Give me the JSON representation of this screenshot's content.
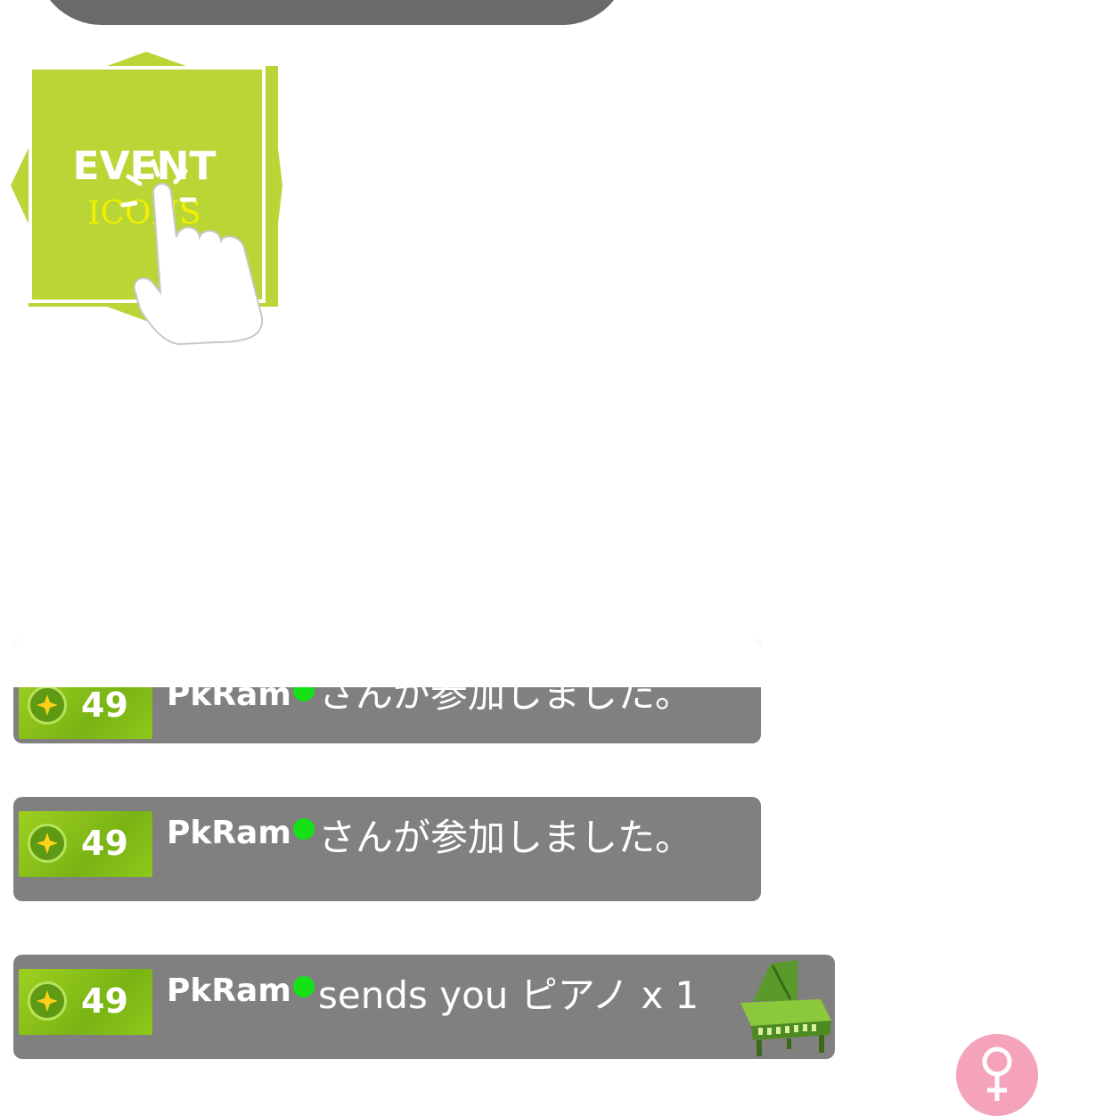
{
  "event_icon": {
    "line1": "EVENT",
    "line2": "ICONS"
  },
  "feed": [
    {
      "level": "49",
      "username": "PkRam",
      "message": "さんが参加しました。",
      "online": true
    },
    {
      "level": "49",
      "username": "PkRam",
      "message": "さんが参加しました。",
      "online": true
    },
    {
      "level": "49",
      "username": "PkRam",
      "message": "sends you ピアノ x 1",
      "online": true,
      "gift_icon": "piano-icon"
    }
  ],
  "gender_icon": "female-symbol-icon",
  "colors": {
    "row_bg": "#808080",
    "badge_green": "#8cc81c",
    "online_green": "#16e016",
    "gender_pink": "#f5a3bb"
  }
}
